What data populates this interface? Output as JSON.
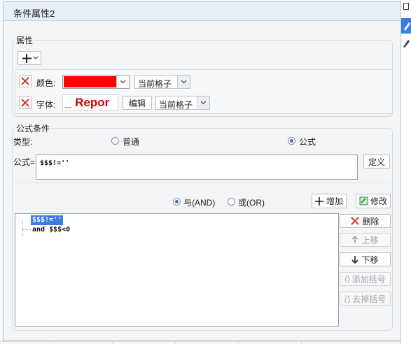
{
  "dialog": {
    "title": "条件属性2"
  },
  "attributes": {
    "legend": "属性",
    "add_icon": "plus-icon",
    "color_row": {
      "label": "颜色:",
      "swatch": "#ff0000",
      "scope": "当前格子"
    },
    "font_row": {
      "label": "字体:",
      "preview": "_ Repor",
      "preview_color": "#d40000",
      "edit": "编辑",
      "scope": "当前格子"
    }
  },
  "formula_condition": {
    "legend": "公式条件",
    "type_label": "类型:",
    "option_normal": "普通",
    "option_formula": "公式",
    "selected_type": "公式",
    "formula_label": "公式=",
    "formula_value": "$$$!=''",
    "define_button": "定义",
    "logic_and": "与(AND)",
    "logic_or": "或(OR)",
    "selected_logic": "与(AND)",
    "add_button": "增加",
    "modify_button": "修改",
    "delete_button": "删除",
    "move_up_button": "上移",
    "move_down_button": "下移",
    "add_bracket_button": "添加括号",
    "remove_bracket_button": "去掉括号",
    "conditions": [
      "$$$!=''",
      "and $$$<0"
    ]
  },
  "colors": {
    "accent": "#3a6fc4",
    "delete_red": "#d93025",
    "selection": "#3a7fe0"
  }
}
